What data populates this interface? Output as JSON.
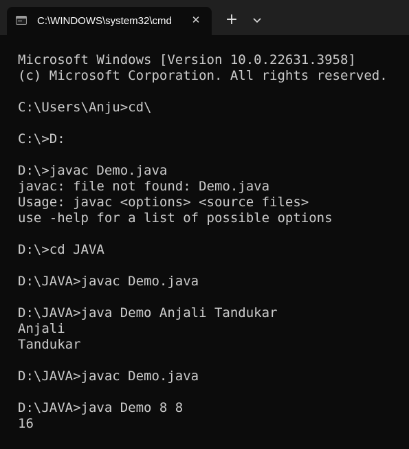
{
  "window": {
    "tab_title": "C:\\WINDOWS\\system32\\cmd",
    "tab_icon": "terminal-icon",
    "close_icon": "close-icon",
    "new_tab_icon": "plus-icon",
    "dropdown_icon": "chevron-down-icon"
  },
  "console": {
    "lines": [
      "Microsoft Windows [Version 10.0.22631.3958]",
      "(c) Microsoft Corporation. All rights reserved.",
      "",
      "C:\\Users\\Anju>cd\\",
      "",
      "C:\\>D:",
      "",
      "D:\\>javac Demo.java",
      "javac: file not found: Demo.java",
      "Usage: javac <options> <source files>",
      "use -help for a list of possible options",
      "",
      "D:\\>cd JAVA",
      "",
      "D:\\JAVA>javac Demo.java",
      "",
      "D:\\JAVA>java Demo Anjali Tandukar",
      "Anjali",
      "Tandukar",
      "",
      "D:\\JAVA>javac Demo.java",
      "",
      "D:\\JAVA>java Demo 8 8",
      "16"
    ]
  },
  "colors": {
    "background": "#0c0c0c",
    "titlebar": "#202020",
    "text": "#cccccc"
  }
}
